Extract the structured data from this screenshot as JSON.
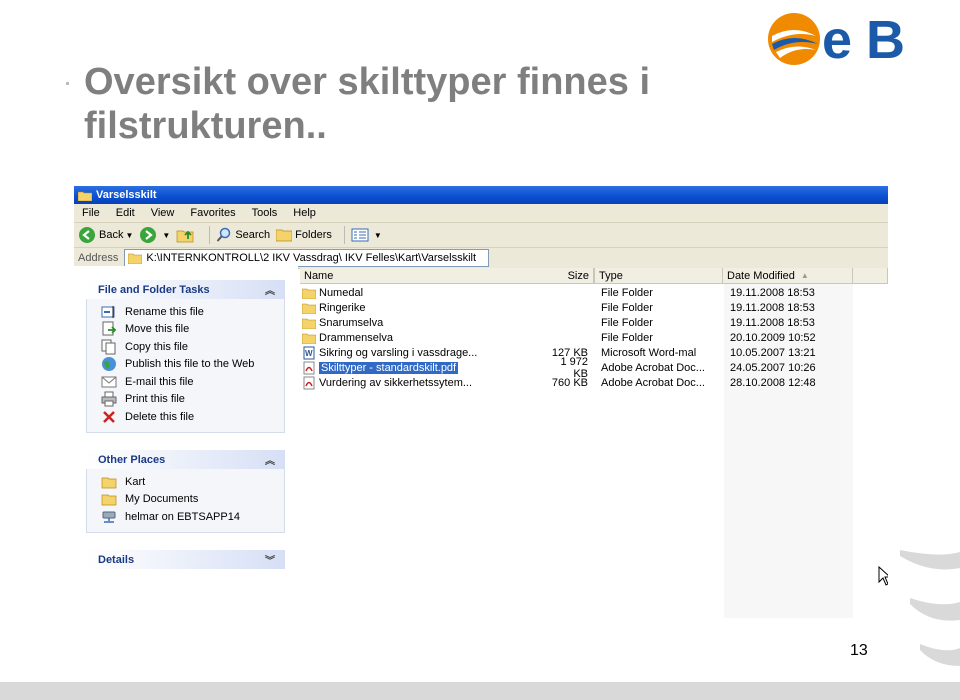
{
  "slide": {
    "title": "Oversikt over skilttyper finnes i filstrukturen..",
    "page_number": "13",
    "logo_text": "eB",
    "colors": {
      "title": "#7f7f7f",
      "logo_blue": "#1a5aa8",
      "logo_orange": "#f08a00"
    }
  },
  "window": {
    "title": "Varselsskilt",
    "menu": [
      "File",
      "Edit",
      "View",
      "Favorites",
      "Tools",
      "Help"
    ],
    "toolbar": {
      "back": "Back",
      "search": "Search",
      "folders": "Folders"
    },
    "address_label": "Address",
    "address": "K:\\INTERNKONTROLL\\2 IKV Vassdrag\\ IKV Felles\\Kart\\Varselsskilt"
  },
  "tasks_panel": {
    "title": "File and Folder Tasks",
    "items": [
      {
        "label": "Rename this file",
        "icon": "rename-icon"
      },
      {
        "label": "Move this file",
        "icon": "move-icon"
      },
      {
        "label": "Copy this file",
        "icon": "copy-icon"
      },
      {
        "label": "Publish this file to the Web",
        "icon": "globe-icon"
      },
      {
        "label": "E-mail this file",
        "icon": "email-icon"
      },
      {
        "label": "Print this file",
        "icon": "printer-icon"
      },
      {
        "label": "Delete this file",
        "icon": "delete-icon"
      }
    ]
  },
  "places_panel": {
    "title": "Other Places",
    "items": [
      {
        "label": "Kart",
        "icon": "folder-icon"
      },
      {
        "label": "My Documents",
        "icon": "folder-icon"
      },
      {
        "label": "helmar on EBTSAPP14",
        "icon": "network-drive-icon"
      }
    ]
  },
  "details_panel": {
    "title": "Details"
  },
  "columns": {
    "name": "Name",
    "size": "Size",
    "type": "Type",
    "date": "Date Modified"
  },
  "files": [
    {
      "name": "Numedal",
      "size": "",
      "type": "File Folder",
      "date": "19.11.2008 18:53",
      "icon": "folder-icon"
    },
    {
      "name": "Ringerike",
      "size": "",
      "type": "File Folder",
      "date": "19.11.2008 18:53",
      "icon": "folder-icon"
    },
    {
      "name": "Snarumselva",
      "size": "",
      "type": "File Folder",
      "date": "19.11.2008 18:53",
      "icon": "folder-icon"
    },
    {
      "name": "Drammenselva",
      "size": "",
      "type": "File Folder",
      "date": "20.10.2009 10:52",
      "icon": "folder-icon"
    },
    {
      "name": "Sikring og varsling i vassdrage...",
      "size": "127 KB",
      "type": "Microsoft Word-mal",
      "date": "10.05.2007 13:21",
      "icon": "word-icon"
    },
    {
      "name": "Skilttyper - standardskilt.pdf",
      "size": "1 972 KB",
      "type": "Adobe Acrobat Doc...",
      "date": "24.05.2007 10:26",
      "icon": "pdf-icon",
      "selected": true
    },
    {
      "name": "Vurdering av sikkerhetssytem...",
      "size": "760 KB",
      "type": "Adobe Acrobat Doc...",
      "date": "28.10.2008 12:48",
      "icon": "pdf-icon"
    }
  ]
}
